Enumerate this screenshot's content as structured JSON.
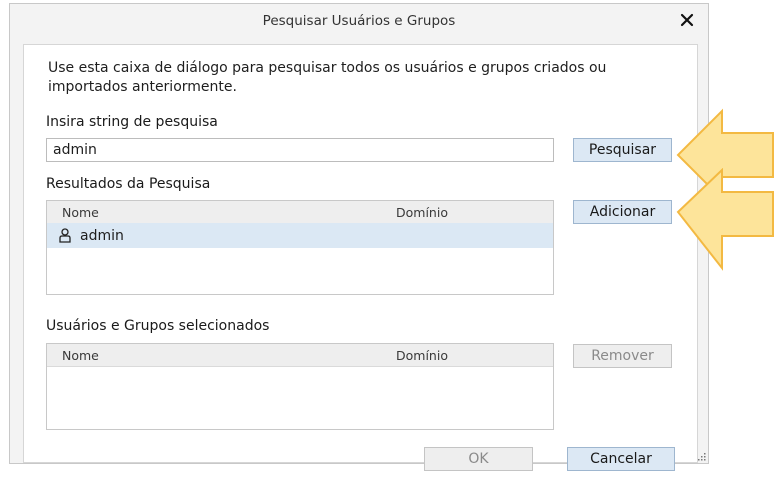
{
  "dialog": {
    "title": "Pesquisar Usuários e Grupos",
    "description": "Use esta caixa de diálogo para pesquisar todos os usuários e grupos criados ou importados anteriormente.",
    "search_label": "Insira string de pesquisa",
    "search_value": "admin",
    "search_button": "Pesquisar",
    "results_label": "Resultados da Pesquisa",
    "results_table": {
      "columns": [
        "Nome",
        "Domínio"
      ],
      "rows": [
        {
          "name": "admin",
          "domain": ""
        }
      ]
    },
    "add_button": "Adicionar",
    "selected_label": "Usuários e Grupos selecionados",
    "selected_table": {
      "columns": [
        "Nome",
        "Domínio"
      ],
      "rows": []
    },
    "remove_button": "Remover",
    "ok_button": "OK",
    "cancel_button": "Cancelar"
  },
  "icons": {
    "close": "close-icon",
    "user": "user-icon",
    "arrows": "highlight-arrow-icon"
  },
  "colors": {
    "arrow_fill": "#fde49a",
    "arrow_stroke": "#f3b942",
    "button_bg": "#dce8f4",
    "selected_row_bg": "#dbe8f4"
  }
}
